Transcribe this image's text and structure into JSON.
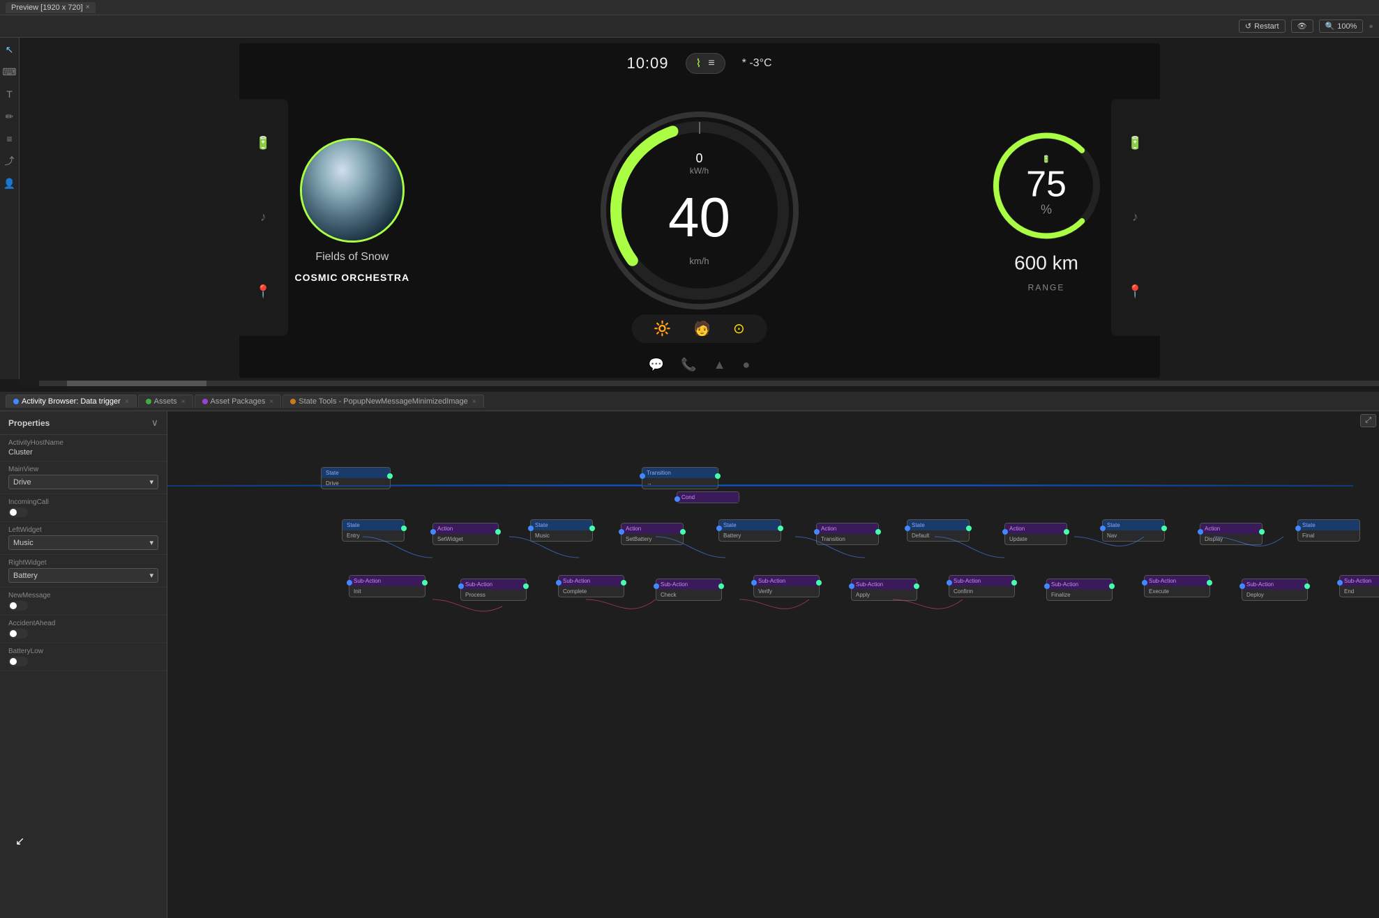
{
  "topbar": {
    "tab_label": "Preview [1920 x 720]"
  },
  "toolbar": {
    "restart_label": "Restart",
    "eye_label": "👁",
    "zoom_label": "100%"
  },
  "sidebar": {
    "icons": [
      "cursor",
      "mouse",
      "text",
      "brush",
      "layers",
      "share",
      "users"
    ]
  },
  "dashboard": {
    "time": "10:09",
    "weather": "* -3°C",
    "speed": "40",
    "speed_unit": "km/h",
    "power_value": "0",
    "power_unit": "kW/h",
    "music_title": "Fields of Snow",
    "music_artist": "COSMIC ORCHESTRA",
    "battery_percent": "75",
    "battery_sign": "%",
    "range_km": "600 km",
    "range_label": "RANGE",
    "status_icons": [
      "fog-lights",
      "seat-heat",
      "tire-pressure"
    ]
  },
  "tabs": [
    {
      "id": "activity",
      "label": "Activity Browser: Data trigger",
      "dot": "blue",
      "active": true
    },
    {
      "id": "assets",
      "label": "Assets",
      "dot": "green",
      "active": false
    },
    {
      "id": "packages",
      "label": "Asset Packages",
      "dot": "purple",
      "active": false
    },
    {
      "id": "state-tools",
      "label": "State Tools - PopupNewMessageMinimizedImage",
      "dot": "orange",
      "active": false
    }
  ],
  "properties": {
    "title": "Properties",
    "fields": [
      {
        "label": "ActivityHostName",
        "value": "Cluster",
        "type": "text"
      },
      {
        "label": "MainView",
        "value": "Drive",
        "type": "select"
      },
      {
        "label": "IncomingCall",
        "value": "",
        "type": "toggle",
        "on": false
      },
      {
        "label": "LeftWidget",
        "value": "Music",
        "type": "select"
      },
      {
        "label": "RightWidget",
        "value": "Battery",
        "type": "select"
      },
      {
        "label": "NewMessage",
        "value": "",
        "type": "toggle",
        "on": false
      },
      {
        "label": "AccidentAhead",
        "value": "",
        "type": "toggle",
        "on": false
      },
      {
        "label": "BatteryLow",
        "value": "",
        "type": "toggle",
        "on": false
      }
    ]
  }
}
